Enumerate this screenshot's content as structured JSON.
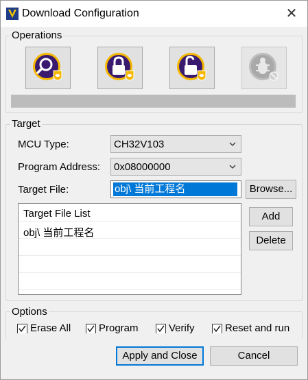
{
  "window": {
    "title": "Download Configuration",
    "close_glyph": "✕"
  },
  "operations": {
    "title": "Operations",
    "buttons": [
      {
        "icon": "search-verify-icon",
        "enabled": true
      },
      {
        "icon": "lock-icon",
        "enabled": true
      },
      {
        "icon": "unlock-icon",
        "enabled": true
      },
      {
        "icon": "bug-icon",
        "enabled": false
      }
    ],
    "progress": 0
  },
  "target": {
    "title": "Target",
    "mcu_type_label": "MCU Type:",
    "mcu_type_value": "CH32V103",
    "program_address_label": "Program Address:",
    "program_address_value": "0x08000000",
    "target_file_label": "Target File:",
    "target_file_value": "obj\\ 当前工程名",
    "browse_label": "Browse...",
    "add_label": "Add",
    "delete_label": "Delete",
    "file_list": {
      "header": "Target File List",
      "items": [
        "obj\\ 当前工程名"
      ]
    }
  },
  "options": {
    "title": "Options",
    "checkboxes": [
      {
        "label": "Erase All",
        "checked": true
      },
      {
        "label": "Program",
        "checked": true
      },
      {
        "label": "Verify",
        "checked": true
      },
      {
        "label": "Reset and run",
        "checked": true
      }
    ]
  },
  "footer": {
    "apply_label": "Apply and Close",
    "cancel_label": "Cancel"
  },
  "colors": {
    "accent": "#0078d7",
    "icon_purple": "#3a1a6e",
    "shield_yellow": "#f5b800"
  }
}
